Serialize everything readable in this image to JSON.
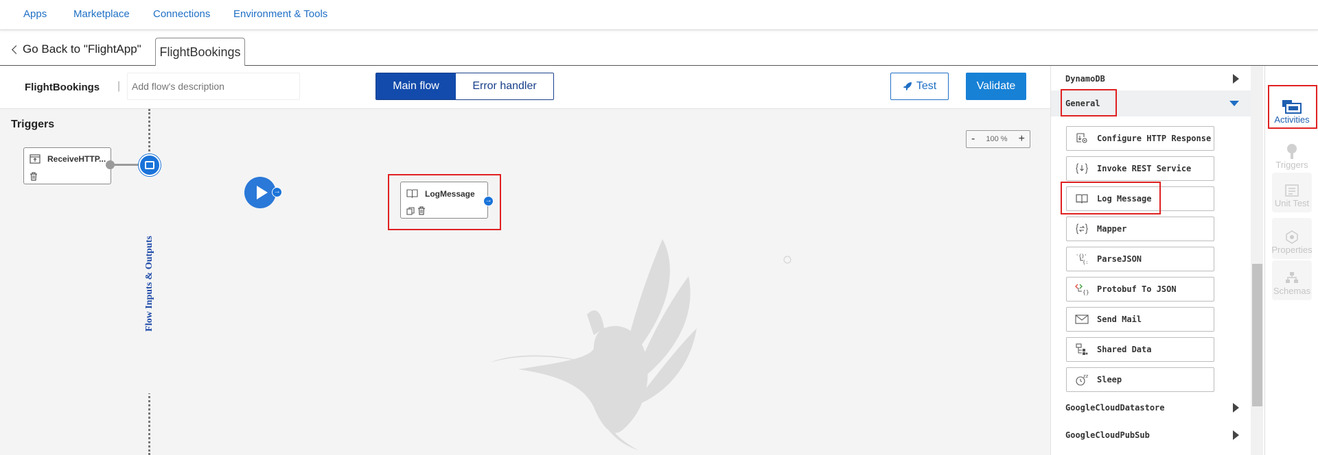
{
  "nav": {
    "items": [
      "Apps",
      "Marketplace",
      "Connections",
      "Environment & Tools"
    ]
  },
  "tabs": {
    "goback": "Go Back to \"FlightApp\"",
    "flow_tab": "FlightBookings"
  },
  "toolbar": {
    "flow_name": "FlightBookings",
    "separator": "|",
    "description_placeholder": "Add flow's description",
    "main_flow": "Main flow",
    "error_handler": "Error handler",
    "test": "Test",
    "validate": "Validate"
  },
  "canvas": {
    "triggers_label": "Triggers",
    "trigger_name": "ReceiveHTTP...",
    "io_label": "Flow Inputs & Outputs",
    "zoom_minus": "-",
    "zoom_level": "100 %",
    "zoom_plus": "+",
    "activity_name": "LogMessage"
  },
  "panel": {
    "categories_top": [
      "DynamoDB",
      "General"
    ],
    "activities": [
      {
        "label": "Configure HTTP Response",
        "icon": "http-response-icon"
      },
      {
        "label": "Invoke REST Service",
        "icon": "rest-icon"
      },
      {
        "label": "Log Message",
        "icon": "book-icon"
      },
      {
        "label": "Mapper",
        "icon": "mapper-icon"
      },
      {
        "label": "ParseJSON",
        "icon": "json-icon"
      },
      {
        "label": "Protobuf To JSON",
        "icon": "protobuf-icon"
      },
      {
        "label": "Send Mail",
        "icon": "mail-icon"
      },
      {
        "label": "Shared Data",
        "icon": "shared-data-icon"
      },
      {
        "label": "Sleep",
        "icon": "sleep-icon"
      }
    ],
    "categories_bottom": [
      "GoogleCloudDatastore",
      "GoogleCloudPubSub"
    ]
  },
  "sidebar": {
    "tabs": [
      "Activities",
      "Triggers",
      "Unit Test",
      "Properties",
      "Schemas"
    ]
  },
  "colors": {
    "accent": "#1f6fc5",
    "primary_dark": "#124bab",
    "highlight": "#e02020"
  }
}
